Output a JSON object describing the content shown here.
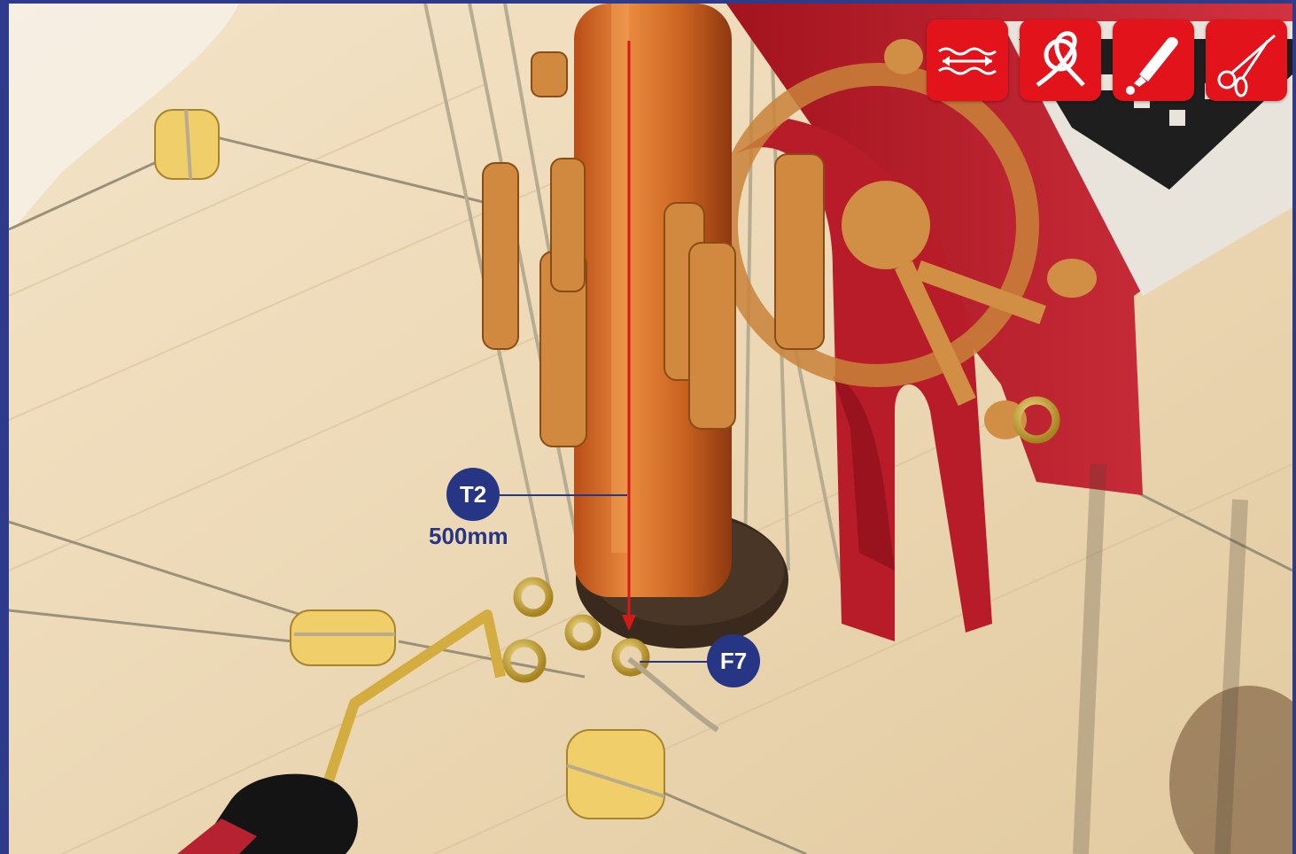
{
  "toolbar": {
    "icons": [
      {
        "name": "measure-length-icon"
      },
      {
        "name": "knot-icon"
      },
      {
        "name": "glue-icon"
      },
      {
        "name": "scissors-icon"
      }
    ],
    "accent_color": "#e3131b"
  },
  "callouts": {
    "line": {
      "code": "T2",
      "length": "500mm"
    },
    "fitting": {
      "code": "F7"
    }
  },
  "colors": {
    "label": "#263584",
    "frame": "#2e3a8c",
    "guide_arrow": "#d21a1a"
  }
}
